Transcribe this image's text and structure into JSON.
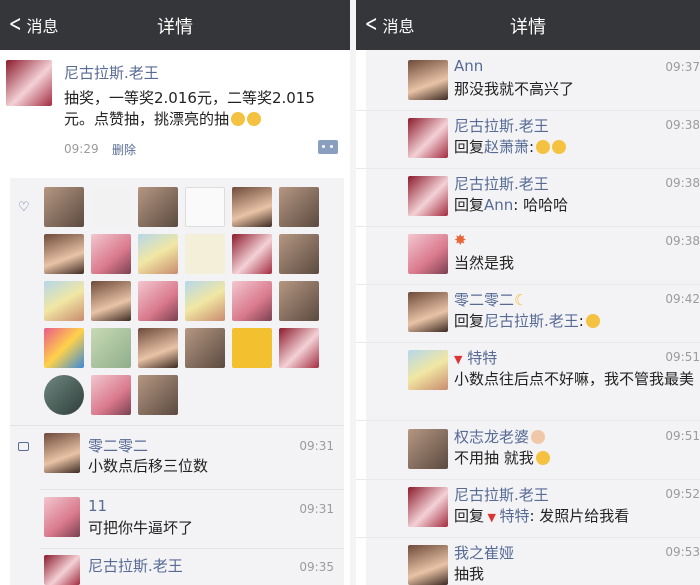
{
  "left": {
    "nav": {
      "back_label": "消息",
      "title": "详情"
    },
    "post": {
      "author": "尼古拉斯.老王",
      "text": "抽奖，一等奖2.016元，二等奖2.015元。点赞抽，挑漂亮的抽",
      "time": "09:29",
      "delete_label": "删除"
    },
    "comments": [
      {
        "name": "零二零二",
        "text": "小数点后移三位数",
        "time": "09:31"
      },
      {
        "name": "11",
        "text": "可把你牛逼坏了",
        "time": "09:31"
      },
      {
        "name": "尼古拉斯.老王",
        "time": "09:35"
      }
    ]
  },
  "right": {
    "nav": {
      "back_label": "消息",
      "title": "详情"
    },
    "comments": [
      {
        "name": "Ann",
        "time": "09:37",
        "text": "那没我就不高兴了"
      },
      {
        "name": "尼古拉斯.老王",
        "time": "09:38",
        "reply_prefix": "回复",
        "reply_to": "赵萧萧",
        "text": ":"
      },
      {
        "name": "尼古拉斯.老王",
        "time": "09:38",
        "reply_prefix": "回复",
        "reply_to": "Ann",
        "text": ": 哈哈哈"
      },
      {
        "name": "",
        "time": "09:38",
        "text": "当然是我"
      },
      {
        "name": "零二零二",
        "time": "09:42",
        "reply_prefix": "回复",
        "reply_to": "尼古拉斯.老王",
        "text": ":"
      },
      {
        "name": "特特",
        "time": "09:51",
        "text": "小数点往后点不好嘛，我不管我最美"
      },
      {
        "name": "权志龙老婆",
        "time": "09:51",
        "text": "不用抽 就我"
      },
      {
        "name": "尼古拉斯.老王",
        "time": "09:52",
        "reply_prefix": "回复",
        "reply_to": "特特",
        "text": ": 发照片给我看"
      },
      {
        "name": "我之崔娅",
        "time": "09:53",
        "text": "抽我"
      }
    ]
  },
  "icons": {
    "back": "chevron-left-icon",
    "like": "heart-icon",
    "comment": "comment-bubble-icon",
    "more": "more-dots-icon"
  },
  "colors": {
    "navbar": "#35363a",
    "name_link": "#576b95",
    "comment_bg": "#f3f3f5"
  }
}
